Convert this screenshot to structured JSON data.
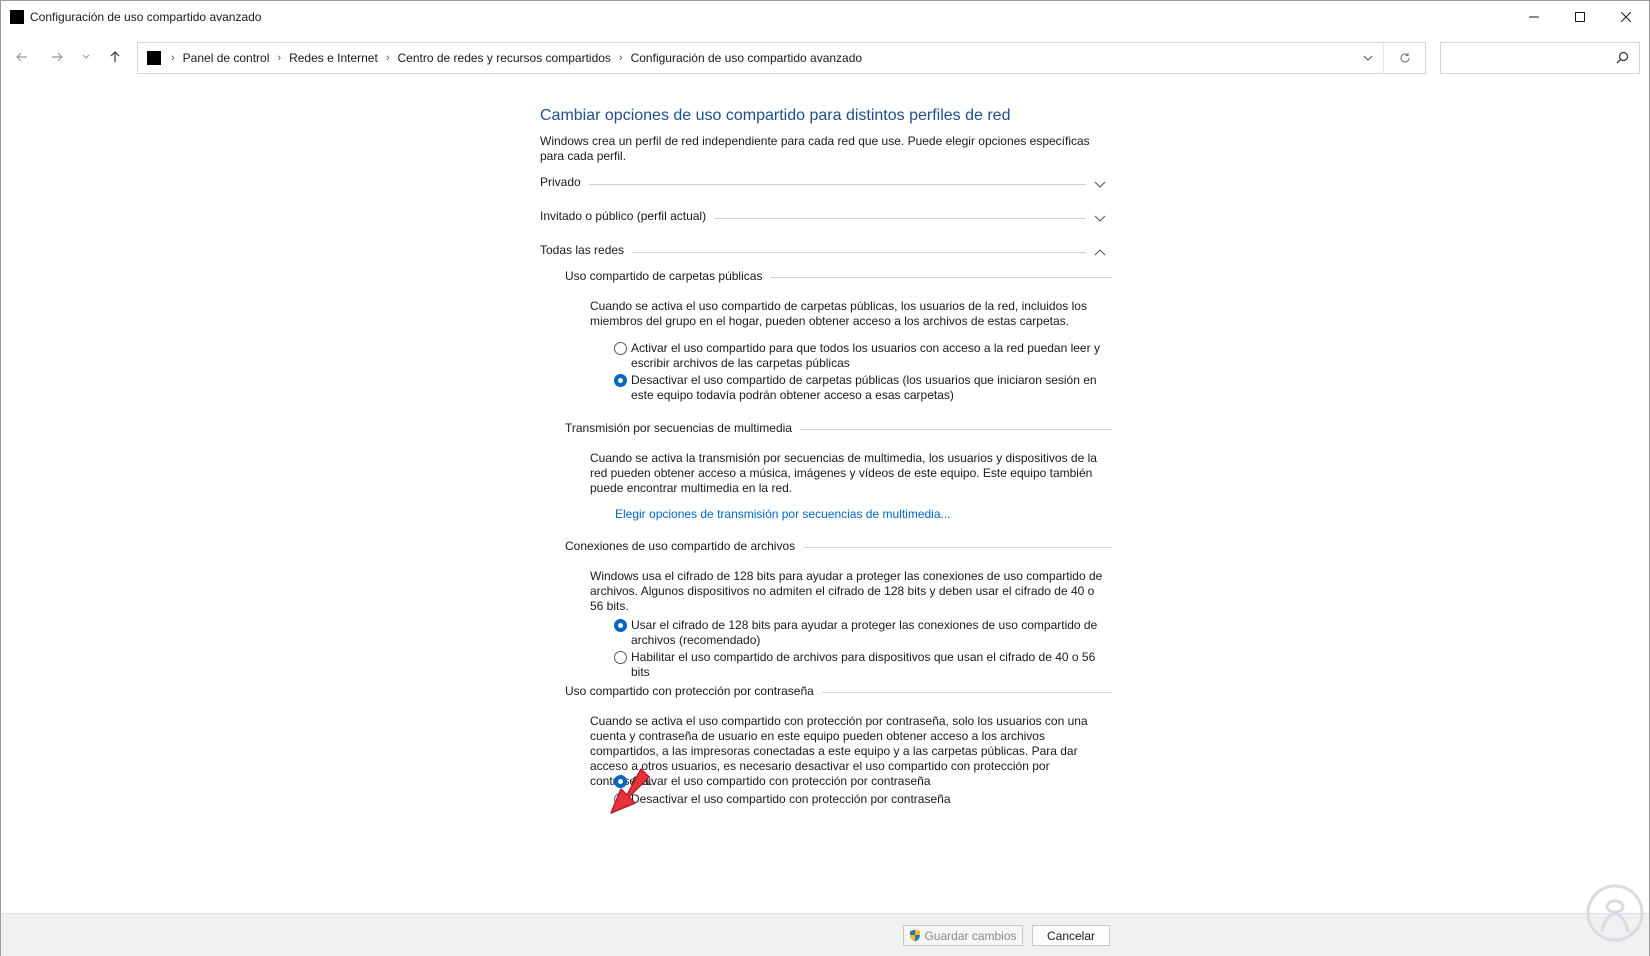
{
  "window": {
    "title": "Configuración de uso compartido avanzado",
    "controls": {
      "minimize_icon": "minimize-icon",
      "maximize_icon": "maximize-icon",
      "close_icon": "close-icon"
    }
  },
  "navigation": {
    "back_icon": "arrow-left-icon",
    "forward_icon": "arrow-right-icon",
    "recent_icon": "chevron-down-icon",
    "up_icon": "arrow-up-icon",
    "breadcrumb": [
      "Panel de control",
      "Redes e Internet",
      "Centro de redes y recursos compartidos",
      "Configuración de uso compartido avanzado"
    ],
    "search_placeholder": ""
  },
  "main": {
    "title": "Cambiar opciones de uso compartido para distintos perfiles de red",
    "intro": "Windows crea un perfil de red independiente para cada red que use. Puede elegir opciones específicas para cada perfil.",
    "profiles": [
      {
        "label": "Privado",
        "expanded": false
      },
      {
        "label": "Invitado o público (perfil actual)",
        "expanded": false
      },
      {
        "label": "Todas las redes",
        "expanded": true
      }
    ],
    "sections": {
      "public_folders": {
        "heading": "Uso compartido de carpetas públicas",
        "description": "Cuando se activa el uso compartido de carpetas públicas, los usuarios de la red, incluidos los miembros del grupo en el hogar, pueden obtener acceso a los archivos de estas carpetas.",
        "options": [
          {
            "label": "Activar el uso compartido para que todos los usuarios con acceso a la red puedan leer y escribir archivos de las carpetas públicas",
            "checked": false
          },
          {
            "label": "Desactivar el uso compartido de carpetas públicas (los usuarios que iniciaron sesión en este equipo todavía podrán obtener acceso a esas carpetas)",
            "checked": true
          }
        ]
      },
      "media_streaming": {
        "heading": "Transmisión por secuencias de multimedia",
        "description": "Cuando se activa la transmisión por secuencias de multimedia, los usuarios y dispositivos de la red pueden obtener acceso a música, imágenes y vídeos de este equipo. Este equipo también puede encontrar multimedia en la red.",
        "link": "Elegir opciones de transmisión por secuencias de multimedia..."
      },
      "file_sharing": {
        "heading": "Conexiones de uso compartido de archivos",
        "description": "Windows usa el cifrado de 128 bits para ayudar a proteger las conexiones de uso compartido de archivos. Algunos dispositivos no admiten el cifrado de 128 bits y deben usar el cifrado de 40 o 56 bits.",
        "options": [
          {
            "label": "Usar el cifrado de 128 bits para ayudar a proteger las conexiones de uso compartido de archivos (recomendado)",
            "checked": true
          },
          {
            "label": "Habilitar el uso compartido de archivos para dispositivos que usan el cifrado de 40 o 56 bits",
            "checked": false
          }
        ]
      },
      "password_protected": {
        "heading": "Uso compartido con protección por contraseña",
        "description": "Cuando se activa el uso compartido con protección por contraseña, solo los usuarios con una cuenta y contraseña de usuario en este equipo pueden obtener acceso a los archivos compartidos, a las impresoras conectadas a este equipo y a las carpetas públicas. Para dar acceso a otros usuarios, es necesario desactivar el uso compartido con protección por contraseña.",
        "options": [
          {
            "label": "Activar el uso compartido con protección por contraseña",
            "checked": true
          },
          {
            "label": "Desactivar el uso compartido con protección por contraseña",
            "checked": false
          }
        ]
      }
    }
  },
  "footer": {
    "save_label": "Guardar cambios",
    "cancel_label": "Cancelar",
    "save_icon": "shield-icon"
  },
  "colors": {
    "title_blue": "#1f4e8c",
    "link_blue": "#0066cc",
    "accent": "#0067c0",
    "arrow_red": "#e8333d"
  }
}
